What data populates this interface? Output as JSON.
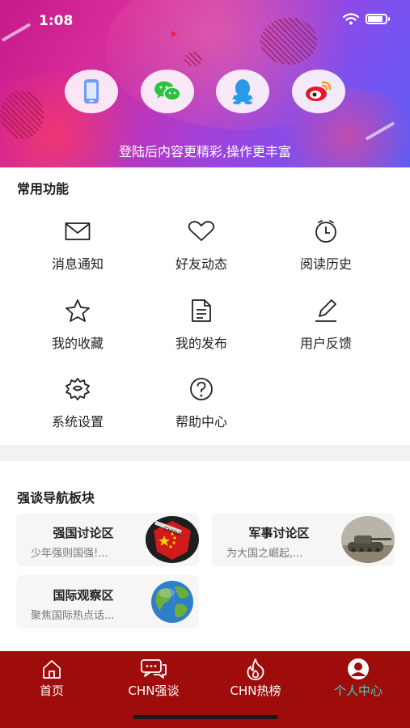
{
  "status_bar": {
    "time": "1:08"
  },
  "header": {
    "login_options": [
      {
        "icon": "phone-icon"
      },
      {
        "icon": "wechat-icon"
      },
      {
        "icon": "qq-icon"
      },
      {
        "icon": "weibo-icon"
      }
    ],
    "login_tip": "登陆后内容更精彩,操作更丰富"
  },
  "common_functions": {
    "title": "常用功能",
    "items": [
      {
        "label": "消息通知",
        "icon": "mail-icon"
      },
      {
        "label": "好友动态",
        "icon": "heart-icon"
      },
      {
        "label": "阅读历史",
        "icon": "clock-icon"
      },
      {
        "label": "我的收藏",
        "icon": "star-icon"
      },
      {
        "label": "我的发布",
        "icon": "document-icon"
      },
      {
        "label": "用户反馈",
        "icon": "pen-icon"
      },
      {
        "label": "系统设置",
        "icon": "gear-icon"
      },
      {
        "label": "帮助中心",
        "icon": "help-icon"
      }
    ]
  },
  "nav_section": {
    "title": "强谈导航板块",
    "boards": [
      {
        "title": "强国讨论区",
        "desc": "少年强则国强!...",
        "image": "china-flag-image"
      },
      {
        "title": "军事讨论区",
        "desc": "为大国之崛起,...",
        "image": "tank-image"
      },
      {
        "title": "国际观察区",
        "desc": "聚焦国际热点话...",
        "image": "globe-image"
      }
    ]
  },
  "tab_bar": {
    "tabs": [
      {
        "label": "首页",
        "icon": "home-icon",
        "active": false
      },
      {
        "label": "CHN强谈",
        "icon": "chat-icon",
        "active": false
      },
      {
        "label": "CHN热榜",
        "icon": "fire-icon",
        "active": false
      },
      {
        "label": "个人中心",
        "icon": "user-icon",
        "active": true
      }
    ]
  },
  "colors": {
    "tab_bar_bg": "#9e0c0c",
    "active_tab": "#3fd4c2",
    "header_gradient_start": "#c71a8a",
    "header_gradient_end": "#5c5df5"
  }
}
